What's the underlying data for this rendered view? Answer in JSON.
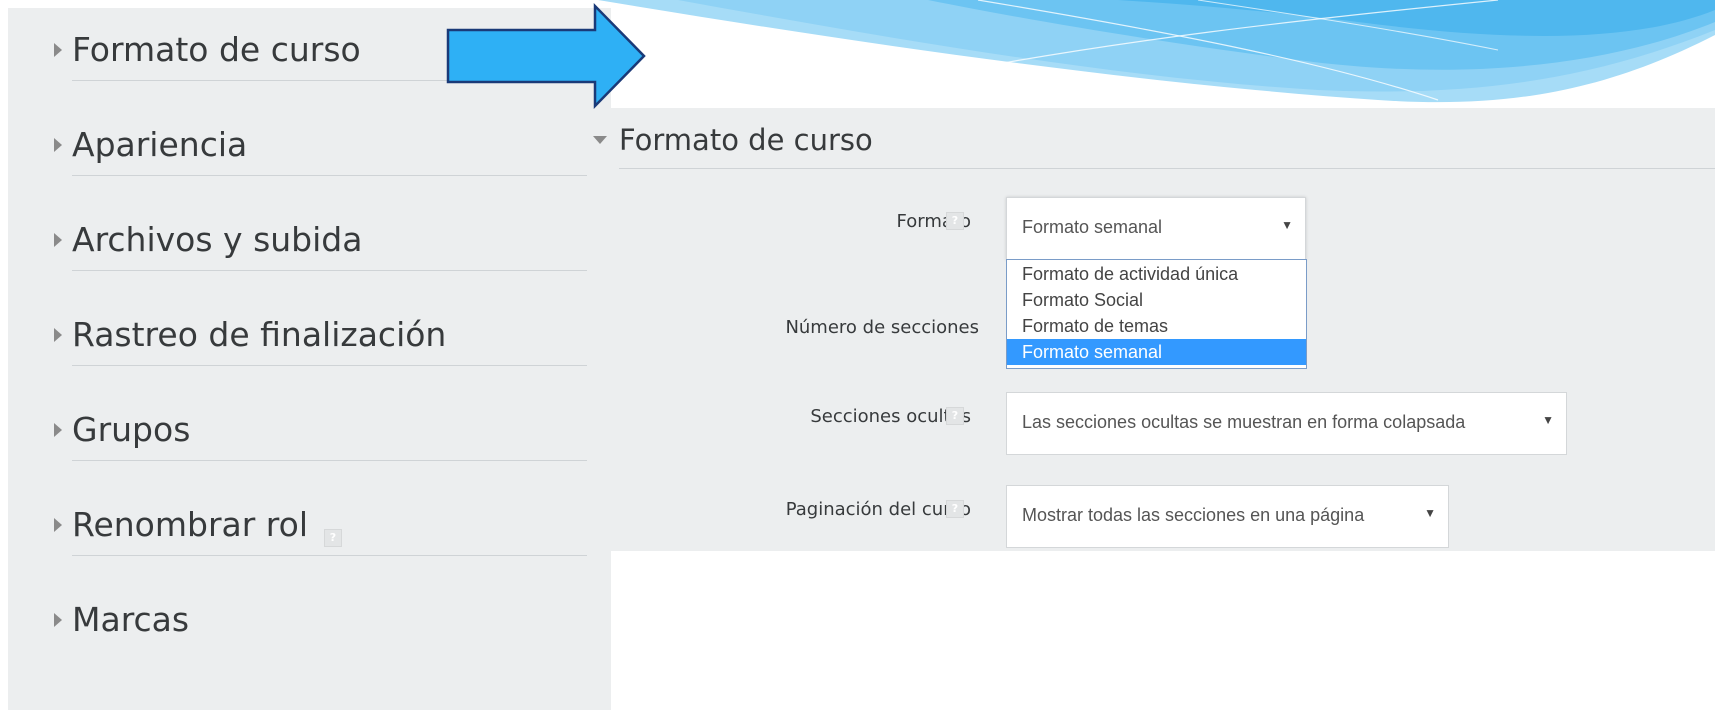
{
  "left_panel": {
    "items": [
      {
        "label": "Formato de curso"
      },
      {
        "label": "Apariencia"
      },
      {
        "label": "Archivos y subida"
      },
      {
        "label": "Rastreo de finalización"
      },
      {
        "label": "Grupos"
      },
      {
        "label": "Renombrar rol",
        "help": "?"
      },
      {
        "label": "Marcas"
      }
    ]
  },
  "form": {
    "section_title": "Formato de curso",
    "help_glyph": "?",
    "formato": {
      "label": "Formato",
      "selected": "Formato semanal",
      "caret": "▼",
      "options": [
        {
          "label": "Formato de actividad única"
        },
        {
          "label": "Formato Social"
        },
        {
          "label": "Formato de temas"
        },
        {
          "label": "Formato semanal"
        }
      ]
    },
    "numero_secciones": {
      "label": "Número de secciones"
    },
    "secciones_ocultas": {
      "label": "Secciones ocultas",
      "selected": "Las secciones ocultas se muestran en forma colapsada",
      "caret": "▼"
    },
    "paginacion": {
      "label": "Paginación del curso",
      "selected": "Mostrar todas las secciones en una página",
      "caret": "▼"
    }
  },
  "colors": {
    "panel_bg": "#eceeef",
    "arrow_fill": "#2eb0f5",
    "selected_option": "#3399ff",
    "wave_light": "#a6dcf7"
  }
}
